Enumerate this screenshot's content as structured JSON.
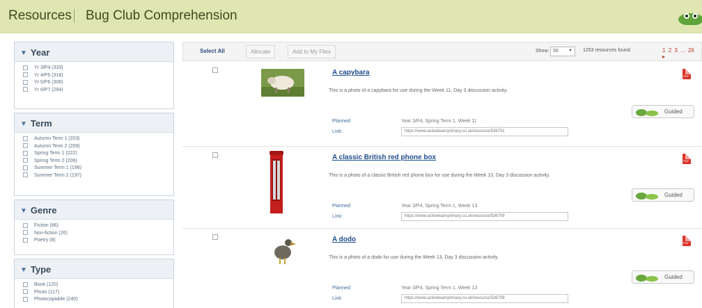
{
  "header": {
    "section": "Resources",
    "title": "Bug Club Comprehension"
  },
  "sidebar": {
    "facets": [
      {
        "title": "Year",
        "items": [
          "Yr 3/P4 (333)",
          "Yr 4/P5 (318)",
          "Yr 5/P6 (308)",
          "Yr 6/P7 (294)"
        ]
      },
      {
        "title": "Term",
        "items": [
          "Autumn Term 1 (203)",
          "Autumn Term 2 (209)",
          "Spring Term 1 (222)",
          "Spring Term 2 (206)",
          "Summer Term 1 (196)",
          "Summer Term 2 (197)"
        ]
      },
      {
        "title": "Genre",
        "items": [
          "Fiction (86)",
          "Non-fiction (26)",
          "Poetry (8)"
        ]
      },
      {
        "title": "Type",
        "items": [
          "Book (120)",
          "Photo (117)",
          "Photocopiable (240)"
        ]
      }
    ]
  },
  "toolbar": {
    "select_all": "Select All",
    "allocate": "Allocate",
    "add_to_my_files": "Add to My Files",
    "show_label": "Show:",
    "show_value": "50",
    "found": "1253 resources found",
    "pages": [
      "1",
      "2",
      "3",
      "...",
      "26",
      "▸"
    ]
  },
  "results": [
    {
      "title": "A capybara",
      "description": "This is a photo of a capybara for use during the Week 11, Day 3 discussion activity.",
      "planned_label": "Planned:",
      "planned_value": "Year 3/P4, Spring Term 1, Week 11",
      "link_label": "Link:",
      "link_value": "https://www.activelearnprimary.co.uk/resource/536701",
      "guided_label": "Guided",
      "pdf_label": "PDF"
    },
    {
      "title": "A classic British red phone box",
      "description": "This is a photo of a classic British red phone box for use during the Week 13, Day 3 discussion activity.",
      "planned_label": "Planned:",
      "planned_value": "Year 3/P4, Spring Term 1, Week 13",
      "link_label": "Link:",
      "link_value": "https://www.activelearnprimary.co.uk/resource/536709",
      "guided_label": "Guided",
      "pdf_label": "PDF"
    },
    {
      "title": "A dodo",
      "description": "This is a photo of a dodo for use during the Week 13, Day 3 discussion activity.",
      "planned_label": "Planned:",
      "planned_value": "Year 3/P4, Spring Term 1, Week 13",
      "link_label": "Link:",
      "link_value": "https://www.activelearnprimary.co.uk/resource/536708",
      "guided_label": "Guided",
      "pdf_label": "PDF"
    }
  ],
  "colors": {
    "header_bg": "#dfe6b2",
    "link_blue": "#1f4e8c",
    "pdf_red": "#d9342b"
  }
}
